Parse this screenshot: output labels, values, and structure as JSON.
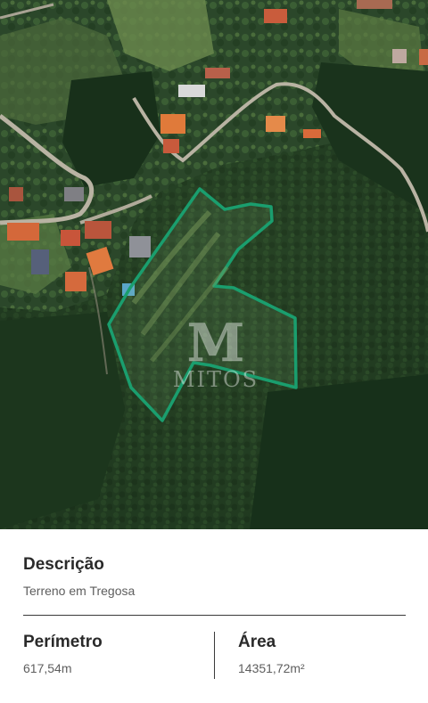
{
  "map": {
    "watermark_monogram": "M",
    "watermark_text": "MITOS",
    "plot_outline_color": "#1a9e6e"
  },
  "description": {
    "title": "Descrição",
    "value": "Terreno em Tregosa"
  },
  "perimeter": {
    "title": "Perímetro",
    "value": "617,54m"
  },
  "area": {
    "title": "Área",
    "value": "14351,72m²"
  }
}
